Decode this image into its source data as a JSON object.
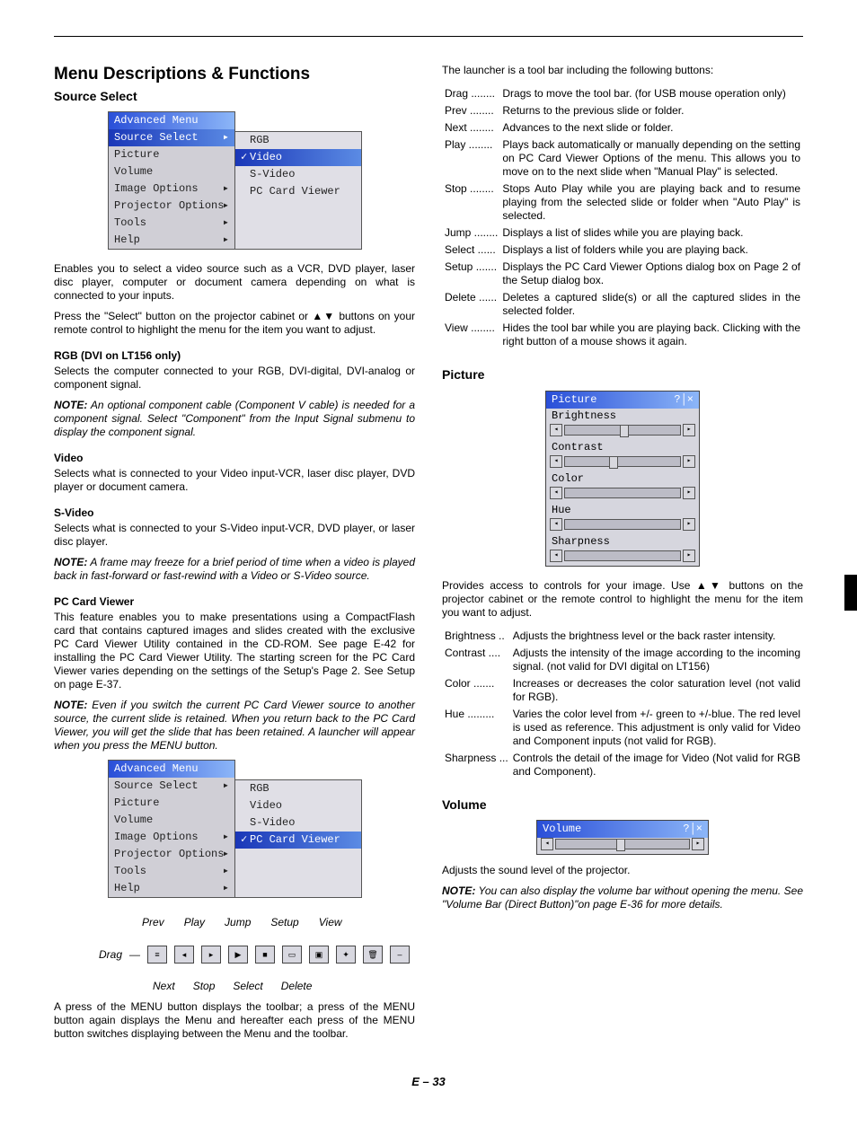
{
  "page": {
    "title": "Menu Descriptions & Functions",
    "num": "E – 33"
  },
  "src": {
    "heading": "Source Select",
    "menuTitle": "Advanced Menu",
    "items": [
      "Source Select",
      "Picture",
      "Volume",
      "Image Options",
      "Projector Options",
      "Tools",
      "Help"
    ],
    "sub": [
      "RGB",
      "Video",
      "S-Video",
      "PC Card Viewer"
    ],
    "p1": "Enables you to select a video source such as a VCR, DVD player, laser disc player, computer or document camera depending on what is connected to your inputs.",
    "p2": "Press the \"Select\" button on the projector cabinet or ▲▼ buttons on your remote control to highlight the menu for the item you want to adjust.",
    "rgbH": "RGB (DVI on LT156 only)",
    "rgbP": "Selects the computer connected to your RGB, DVI-digital, DVI-analog or component signal.",
    "rgbN": "An optional component cable (Component V cable) is needed for a component signal. Select \"Component\" from the Input Signal submenu to display the component signal.",
    "vidH": "Video",
    "vidP": "Selects what is connected to your Video input-VCR, laser disc player, DVD player or document camera.",
    "svH": "S-Video",
    "svP": "Selects what is connected to your S-Video input-VCR, DVD player, or laser disc player.",
    "svN": "A frame may freeze for a brief period of time when a video is played back in fast-forward or fast-rewind with a Video or S-Video source.",
    "pcH": "PC Card Viewer",
    "pcP": "This feature enables you to make presentations using a CompactFlash card that contains captured images and slides created with the exclusive PC Card Viewer Utility contained in the CD-ROM. See page E-42 for installing the PC Card Viewer Utility. The starting screen for the PC Card Viewer varies depending on the settings of the Setup's Page 2. See Setup on page E-37.",
    "pcN": "Even if you switch the current PC Card Viewer source to another source, the current slide is retained. When you return back to the PC Card Viewer, you will get the slide that has been retained. A launcher will appear when you press the MENU button.",
    "tbTop": [
      "Prev",
      "Play",
      "Jump",
      "Setup",
      "View"
    ],
    "tbLeft": "Drag",
    "tbBot": [
      "Next",
      "Stop",
      "Select",
      "Delete"
    ],
    "pcP2": "A press of the MENU button displays the toolbar; a press of the MENU button again displays the Menu and hereafter each press of the MENU button switches displaying between the Menu and the toolbar."
  },
  "launcher": {
    "intro": "The launcher is a tool bar including the following buttons:",
    "rows": [
      {
        "t": "Drag",
        "d": "Drags to move the tool bar. (for USB mouse operation only)"
      },
      {
        "t": "Prev",
        "d": "Returns to the previous slide or folder."
      },
      {
        "t": "Next",
        "d": "Advances to the next slide or folder."
      },
      {
        "t": "Play",
        "d": "Plays back automatically or manually depending on the setting on PC Card Viewer Options of the menu. This allows you to move on to the next slide when \"Manual Play\" is selected."
      },
      {
        "t": "Stop",
        "d": "Stops Auto Play while you are playing back and to resume playing from the selected slide or folder when \"Auto Play\" is selected."
      },
      {
        "t": "Jump",
        "d": "Displays a list of slides while you are playing back."
      },
      {
        "t": "Select",
        "d": "Displays a list of folders while you are playing back."
      },
      {
        "t": "Setup",
        "d": "Displays the PC Card Viewer Options dialog box on Page 2 of the Setup dialog box."
      },
      {
        "t": "Delete",
        "d": "Deletes a captured slide(s) or all the captured slides in the selected folder."
      },
      {
        "t": "View",
        "d": "Hides the tool bar while you are playing back. Clicking with the right button of a mouse shows it again."
      }
    ]
  },
  "pic": {
    "heading": "Picture",
    "title": "Picture",
    "items": [
      "Brightness",
      "Contrast",
      "Color",
      "Hue",
      "Sharpness"
    ],
    "p": "Provides access to controls for your image. Use ▲▼ buttons on the projector cabinet or the remote control to highlight the menu for the item you want to adjust.",
    "rows": [
      {
        "t": "Brightness",
        "d": "Adjusts the brightness level or the back raster intensity."
      },
      {
        "t": "Contrast",
        "d": "Adjusts the intensity of the image according to the incoming signal. (not valid for DVI digital on LT156)"
      },
      {
        "t": "Color",
        "d": "Increases or decreases the color saturation level (not valid for RGB)."
      },
      {
        "t": "Hue",
        "d": "Varies the color level from +/- green to +/-blue. The red level is used as reference. This adjustment is only valid for Video and Component inputs (not valid for RGB)."
      },
      {
        "t": "Sharpness",
        "d": "Controls the detail of the image for Video (Not valid for RGB and Component)."
      }
    ]
  },
  "vol": {
    "heading": "Volume",
    "title": "Volume",
    "p": "Adjusts the sound level of the projector.",
    "n": "You can also display the volume bar without opening the menu. See \"Volume Bar (Direct Button)\"on page E-36 for more details."
  },
  "noteLabel": "NOTE:"
}
